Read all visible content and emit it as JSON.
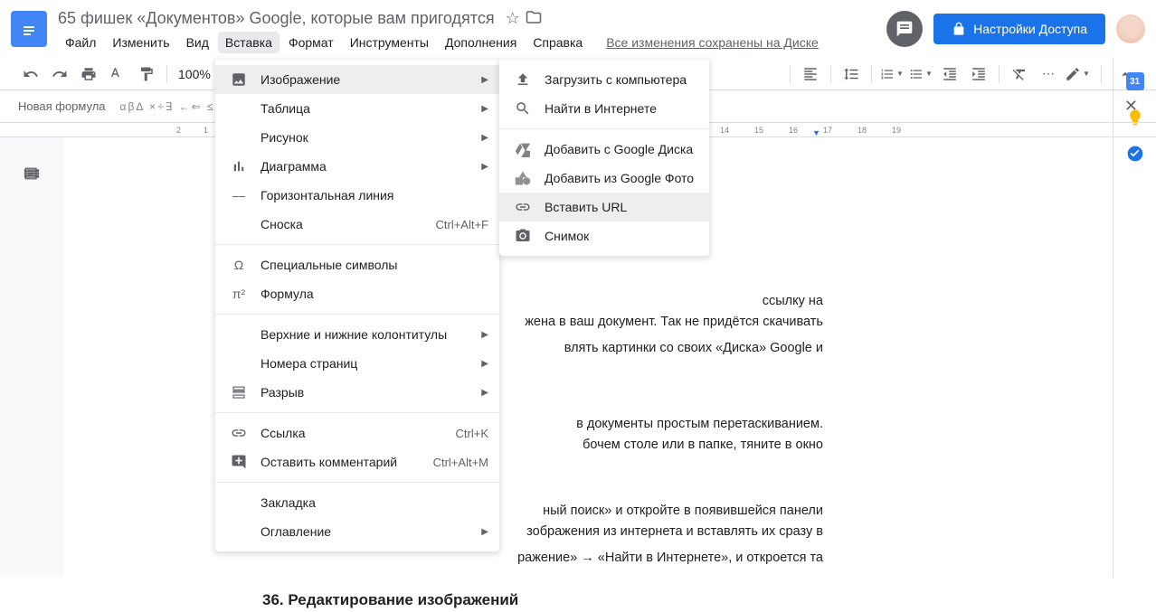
{
  "doc": {
    "title": "65 фишек «Документов» Google, которые вам пригодятся",
    "save_status": "Все изменения сохранены на Диске"
  },
  "menu": {
    "file": "Файл",
    "edit": "Изменить",
    "view": "Вид",
    "insert": "Вставка",
    "format": "Формат",
    "tools": "Инструменты",
    "addons": "Дополнения",
    "help": "Справка"
  },
  "share_button": "Настройки Доступа",
  "toolbar": {
    "zoom": "100%"
  },
  "formula_bar": {
    "label": "Новая формула",
    "symbols": "αβΔ   ×÷∃   ←⇐   ≤≠"
  },
  "ruler": [
    "2",
    "1",
    "14",
    "15",
    "16",
    "17",
    "18",
    "19"
  ],
  "insert_menu": {
    "image": "Изображение",
    "table": "Таблица",
    "drawing": "Рисунок",
    "chart": "Диаграмма",
    "hline": "Горизонтальная линия",
    "footnote": "Сноска",
    "footnote_sc": "Ctrl+Alt+F",
    "special": "Специальные символы",
    "equation": "Формула",
    "headers": "Верхние и нижние колонтитулы",
    "pagenums": "Номера страниц",
    "break": "Разрыв",
    "link": "Ссылка",
    "link_sc": "Ctrl+K",
    "comment": "Оставить комментарий",
    "comment_sc": "Ctrl+Alt+M",
    "bookmark": "Закладка",
    "toc": "Оглавление"
  },
  "image_submenu": {
    "upload": "Загрузить с компьютера",
    "web": "Найти в Интернете",
    "drive": "Добавить с Google Диска",
    "photos": "Добавить из Google Фото",
    "url": "Вставить URL",
    "camera": "Снимок"
  },
  "document_body": {
    "frag1": "ссылку на",
    "frag2": "жена в ваш документ. Так не придётся скачивать",
    "frag3": "влять картинки со своих «Диска» Google и",
    "frag4": "в документы простым перетаскиванием.",
    "frag5": "бочем столе или в папке, тяните в окно",
    "frag6": "ный поиск» и откройте в появившейся панели",
    "frag7": "зображения из интернета и вставлять их сразу в",
    "frag8": "ражение» → «Найти в Интернете», и откроется та",
    "heading": "36. Редактирование изображений"
  }
}
